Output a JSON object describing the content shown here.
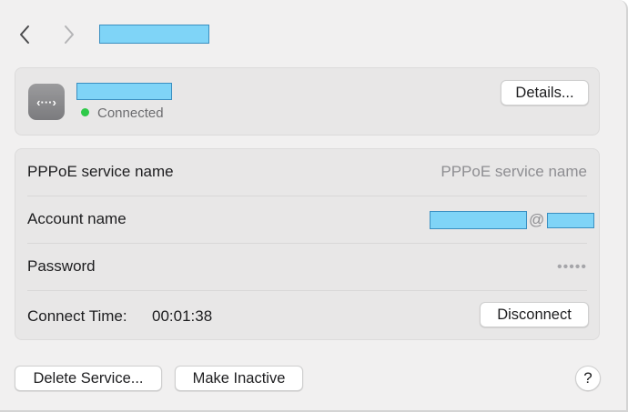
{
  "header": {
    "back_icon": "chevron-left-icon",
    "forward_icon": "chevron-right-icon"
  },
  "service": {
    "icon": "network-service-icon",
    "icon_glyph": "‹···›",
    "status": "Connected",
    "status_color": "#2ec949",
    "details_label": "Details..."
  },
  "form": {
    "pppoe_label": "PPPoE service name",
    "pppoe_placeholder": "PPPoE service name",
    "account_label": "Account name",
    "account_at": "@",
    "password_label": "Password",
    "password_value": "•••••",
    "connect_time_label": "Connect Time:",
    "connect_time_value": "00:01:38",
    "disconnect_label": "Disconnect"
  },
  "footer": {
    "delete_label": "Delete Service...",
    "inactive_label": "Make Inactive",
    "help_label": "?"
  }
}
